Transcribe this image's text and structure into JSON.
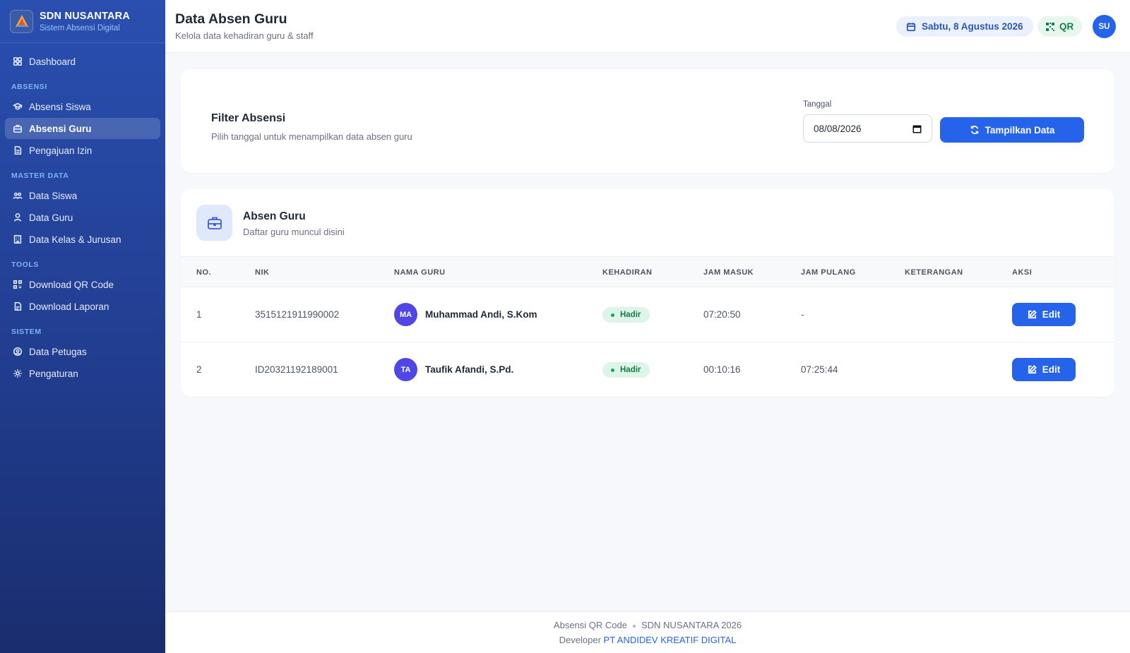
{
  "brand": {
    "name": "SDN NUSANTARA",
    "subtitle": "Sistem Absensi Digital"
  },
  "sidebar": {
    "dashboard": "Dashboard",
    "sections": {
      "absensi": "ABSENSI",
      "master": "MASTER DATA",
      "tools": "TOOLS",
      "sistem": "SISTEM"
    },
    "items": {
      "absensi_siswa": "Absensi Siswa",
      "absensi_guru": "Absensi Guru",
      "pengajuan_izin": "Pengajuan Izin",
      "data_siswa": "Data Siswa",
      "data_guru": "Data Guru",
      "data_kelas": "Data Kelas & Jurusan",
      "download_qr": "Download QR Code",
      "download_laporan": "Download Laporan",
      "data_petugas": "Data Petugas",
      "pengaturan": "Pengaturan"
    },
    "active": "absensi_guru"
  },
  "header": {
    "title": "Data Absen Guru",
    "subtitle": "Kelola data kehadiran guru & staff",
    "date": "Sabtu, 8 Agustus 2026",
    "qr_label": "QR",
    "user_initials": "SU"
  },
  "filter": {
    "title": "Filter Absensi",
    "subtitle": "Pilih tanggal untuk menampilkan data absen guru",
    "date_label": "Tanggal",
    "date_value": "08/08/2026",
    "button_label": "Tampilkan Data"
  },
  "table": {
    "title": "Absen Guru",
    "subtitle": "Daftar guru muncul disini",
    "columns": {
      "no": "NO.",
      "nik": "NIK",
      "nama": "NAMA GURU",
      "kehadiran": "KEHADIRAN",
      "jam_masuk": "JAM MASUK",
      "jam_pulang": "JAM PULANG",
      "keterangan": "KETERANGAN",
      "aksi": "AKSI"
    },
    "rows": [
      {
        "no": "1",
        "nik": "3515121911990002",
        "initials": "MA",
        "nama": "Muhammad Andi, S.Kom",
        "kehadiran": "Hadir",
        "jam_masuk": "07:20:50",
        "jam_pulang": "-",
        "keterangan": "",
        "aksi": "Edit"
      },
      {
        "no": "2",
        "nik": "ID20321192189001",
        "initials": "TA",
        "nama": "Taufik Afandi, S.Pd.",
        "kehadiran": "Hadir",
        "jam_masuk": "00:10:16",
        "jam_pulang": "07:25:44",
        "keterangan": "",
        "aksi": "Edit"
      }
    ]
  },
  "footer": {
    "app": "Absensi QR Code",
    "copyright": "SDN NUSANTARA 2026",
    "developer_prefix": "Developer",
    "developer_name": "PT ANDIDEV KREATIF DIGITAL"
  },
  "colors": {
    "primary": "#2563eb",
    "sidebar": "#223f93",
    "success_bg": "#dcf5e8",
    "success_text": "#157a45"
  }
}
